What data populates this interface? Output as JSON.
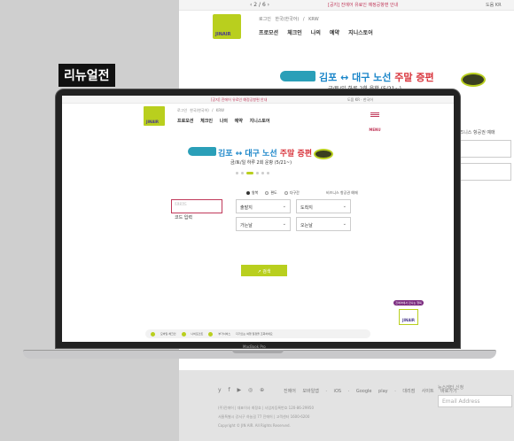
{
  "label": "리뉴얼전",
  "old_site": {
    "pager": "‹ 2 / 6 ›",
    "notice": "[공지] 진에어 유료인 예정공항편 안내",
    "language": "도움 KR",
    "logo_text": "JINAIR",
    "util": "로그인  한국(한국어) / KRW",
    "menu": [
      "프로모션",
      "체크인",
      "나의 예약",
      "지니스토어"
    ],
    "banner_title_a": "김포 ↔ 대구 노선",
    "banner_title_b": "주말 증편",
    "banner_sub": "금/토/일 하루 2회 운항 (5/21~)",
    "biz_link": "비즈니스 항공권 예매",
    "social": "y f ▶ ◎ ⊕",
    "apps": "진에어 모바일앱  ·  iOS  ·  Google play  ·  대리점 사이트 바로가기",
    "newsletter_label": "뉴스레터 신청",
    "email_placeholder": "Email Address",
    "footer_lines": [
      "(주)진에어 | 대표이사 최정호 | 사업자등록번호 120-86-29950",
      "서울특별시 강서구 하늘길 77 진에어 | 고객센터 1600-6200",
      "Copyright © JIN AIR. All Rights Reserved."
    ]
  },
  "new_site": {
    "notice": "[공지] 진에어 유료인 예정공항편 안내",
    "language": "도움 KR · 한국어",
    "logo_text": "JINAIR",
    "util": "로그인  한국(한국어) / KRW",
    "nav": [
      "프로모션",
      "체크인",
      "나의 예약",
      "지니스토어"
    ],
    "menu_label": "MENU",
    "banner_title_a": "김포 ↔ 대구 노선",
    "banner_title_b": "주말 증편",
    "banner_sub": "금/토/일 하루 2회 운항 (5/21~)",
    "trip_types": [
      "왕복",
      "편도",
      "다구간"
    ],
    "biz_link": "비즈니스 항공권 예매",
    "promo": {
      "label": "프로모코드",
      "value": "코드 입력"
    },
    "departure": "출발지",
    "arrival": "도착지",
    "depart_date": "가는날",
    "return_date": "오는날",
    "search_button": "↗ 검색",
    "side_badge": "진에어에서 만나는 행복",
    "side_logo": "JINAIR",
    "quick_items": [
      "모바일 체크인",
      "나비포인트",
      "부가서비스",
      "다가오는 여행 일정을 조회하세요"
    ]
  },
  "device": {
    "brand": "MacBook Pro"
  },
  "colors": {
    "brand_green": "#b9cf1e",
    "brand_purple": "#4a3a8f",
    "accent_red": "#c0395a"
  }
}
